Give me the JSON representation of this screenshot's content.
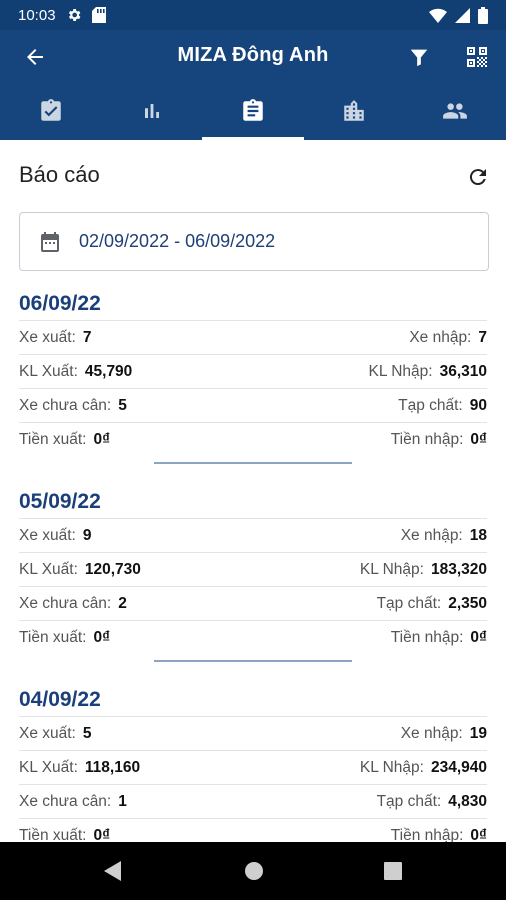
{
  "status_bar": {
    "time": "10:03"
  },
  "app_bar": {
    "title": "MIZA Đông Anh"
  },
  "section": {
    "title": "Báo cáo"
  },
  "date_range": {
    "text": "02/09/2022 - 06/09/2022"
  },
  "labels": {
    "xe_xuat": "Xe xuất:",
    "xe_nhap": "Xe nhập:",
    "kl_xuat": "KL Xuất:",
    "kl_nhap": "KL Nhập:",
    "xe_chua_can": "Xe chưa cân:",
    "tap_chat": "Tạp chất:",
    "tien_xuat": "Tiền xuất:",
    "tien_nhap": "Tiền nhập:"
  },
  "days": [
    {
      "date": "06/09/22",
      "xe_xuat": "7",
      "xe_nhap": "7",
      "kl_xuat": "45,790",
      "kl_nhap": "36,310",
      "xe_chua_can": "5",
      "tap_chat": "90",
      "tien_xuat": "0₫",
      "tien_nhap": "0₫"
    },
    {
      "date": "05/09/22",
      "xe_xuat": "9",
      "xe_nhap": "18",
      "kl_xuat": "120,730",
      "kl_nhap": "183,320",
      "xe_chua_can": "2",
      "tap_chat": "2,350",
      "tien_xuat": "0₫",
      "tien_nhap": "0₫"
    },
    {
      "date": "04/09/22",
      "xe_xuat": "5",
      "xe_nhap": "19",
      "kl_xuat": "118,160",
      "kl_nhap": "234,940",
      "xe_chua_can": "1",
      "tap_chat": "4,830",
      "tien_xuat": "0₫",
      "tien_nhap": "0₫"
    }
  ],
  "colors": {
    "primary": "#16457d",
    "status_bar": "#123f73",
    "date_text": "#1a3f7a"
  }
}
